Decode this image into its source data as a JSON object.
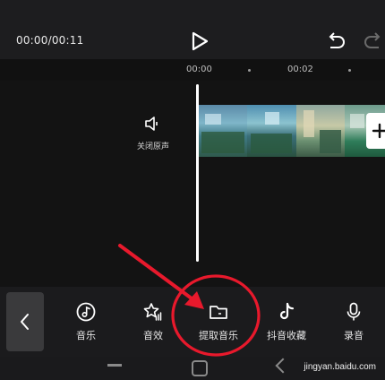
{
  "player": {
    "timecode": "00:00/00:11"
  },
  "ruler": {
    "marks": [
      "00:00",
      "00:02"
    ]
  },
  "track": {
    "audio_toggle_label": "关闭原声"
  },
  "toolbar": {
    "items": [
      {
        "label": "音乐",
        "icon": "music-note-icon"
      },
      {
        "label": "音效",
        "icon": "star-sparkle-icon"
      },
      {
        "label": "提取音乐",
        "icon": "folder-icon"
      },
      {
        "label": "抖音收藏",
        "icon": "douyin-icon"
      },
      {
        "label": "录音",
        "icon": "microphone-icon"
      }
    ]
  },
  "watermark": "jingyan.baidu.com",
  "colors": {
    "annotation": "#e8192c",
    "background": "#111111",
    "toolbar": "#1b1b1d"
  }
}
